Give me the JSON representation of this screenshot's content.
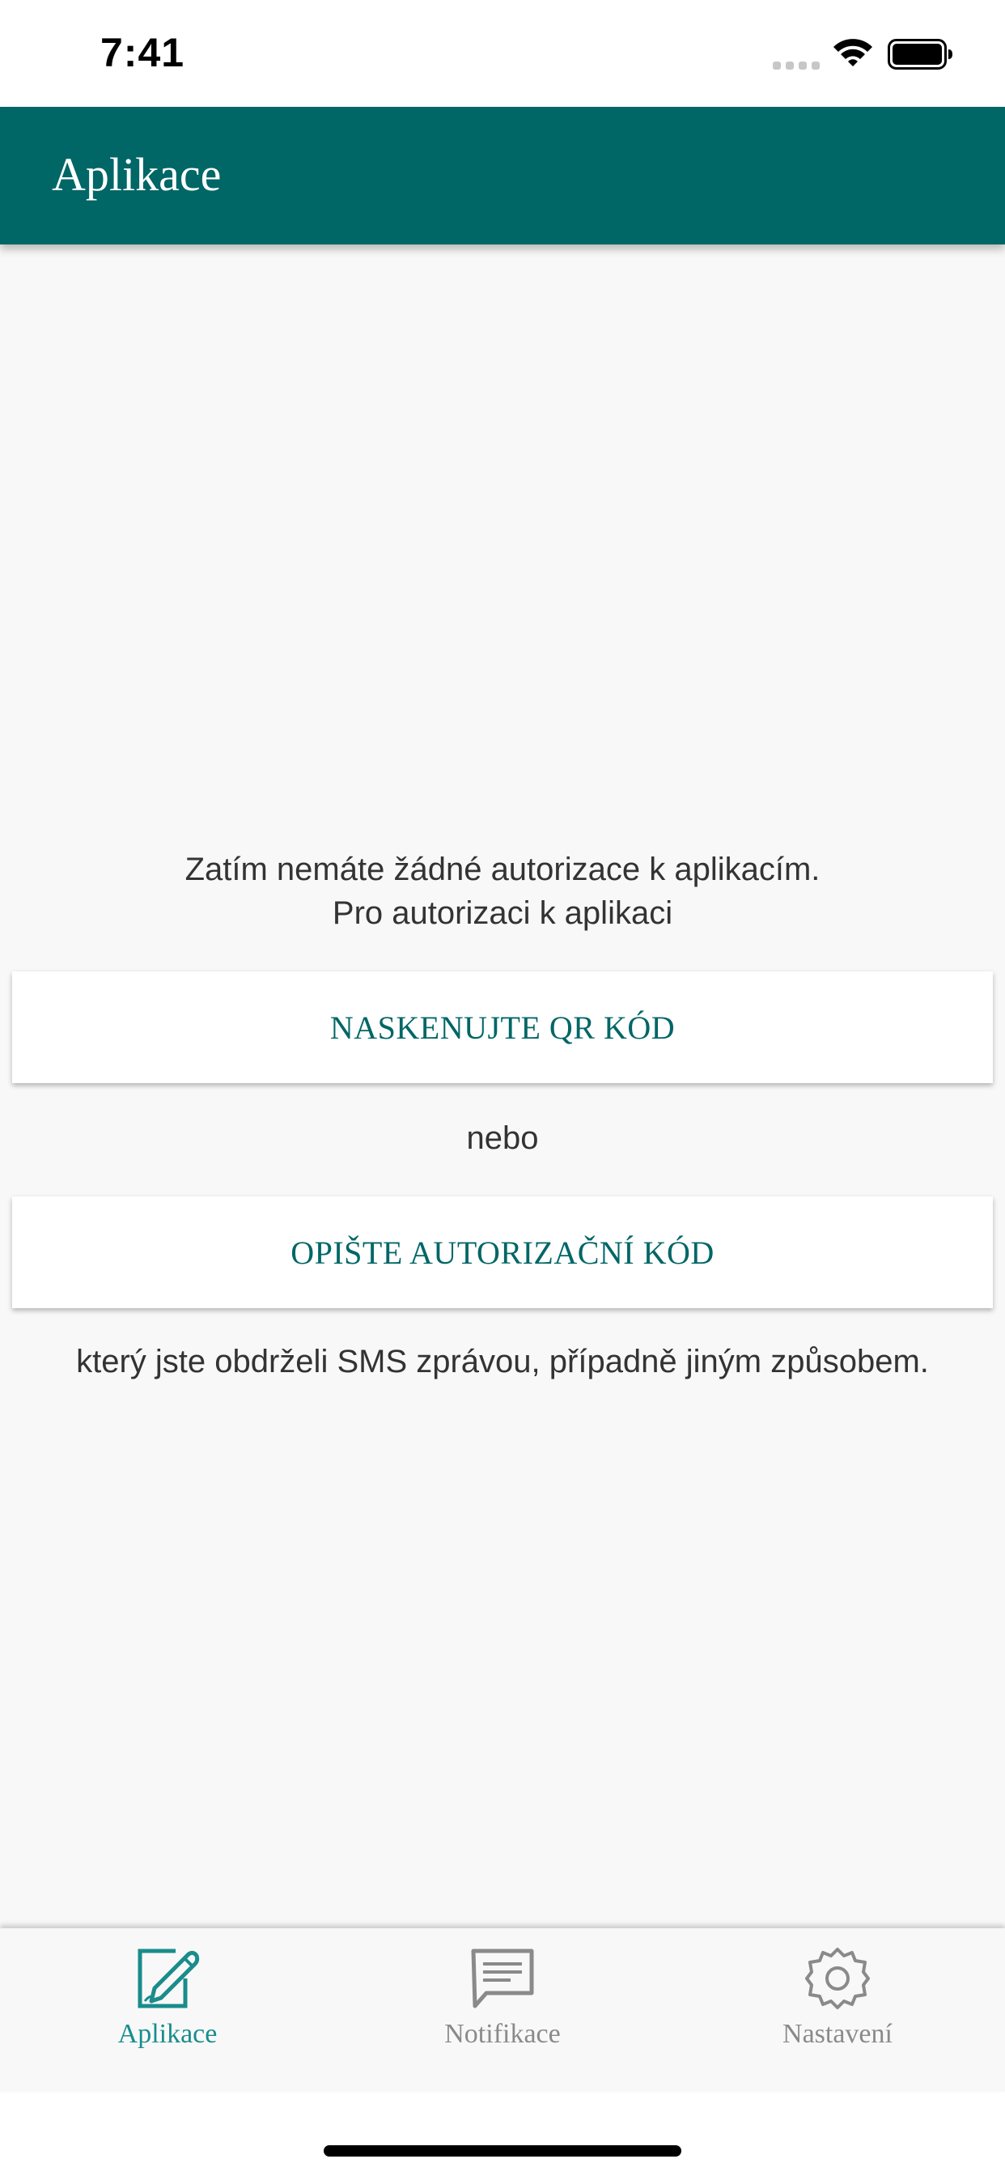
{
  "status_bar": {
    "time": "7:41"
  },
  "header": {
    "title": "Aplikace"
  },
  "content": {
    "message_line1": "Zatím nemáte žádné autorizace k aplikacím.",
    "message_line2": "Pro autorizaci k aplikaci",
    "scan_button_label": "NASKENUJTE QR KÓD",
    "or_text": "nebo",
    "code_button_label": "OPIŠTE AUTORIZAČNÍ KÓD",
    "footer_text": "který jste obdrželi SMS zprávou, případně jiným způsobem."
  },
  "tabs": [
    {
      "label": "Aplikace",
      "icon": "edit-document-icon",
      "active": true
    },
    {
      "label": "Notifikace",
      "icon": "message-icon",
      "active": false
    },
    {
      "label": "Nastavení",
      "icon": "gear-icon",
      "active": false
    }
  ],
  "colors": {
    "primary": "#006666",
    "tab_active": "#1a8c8c",
    "tab_inactive": "#8a8a8a",
    "background": "#f8f8f8"
  }
}
